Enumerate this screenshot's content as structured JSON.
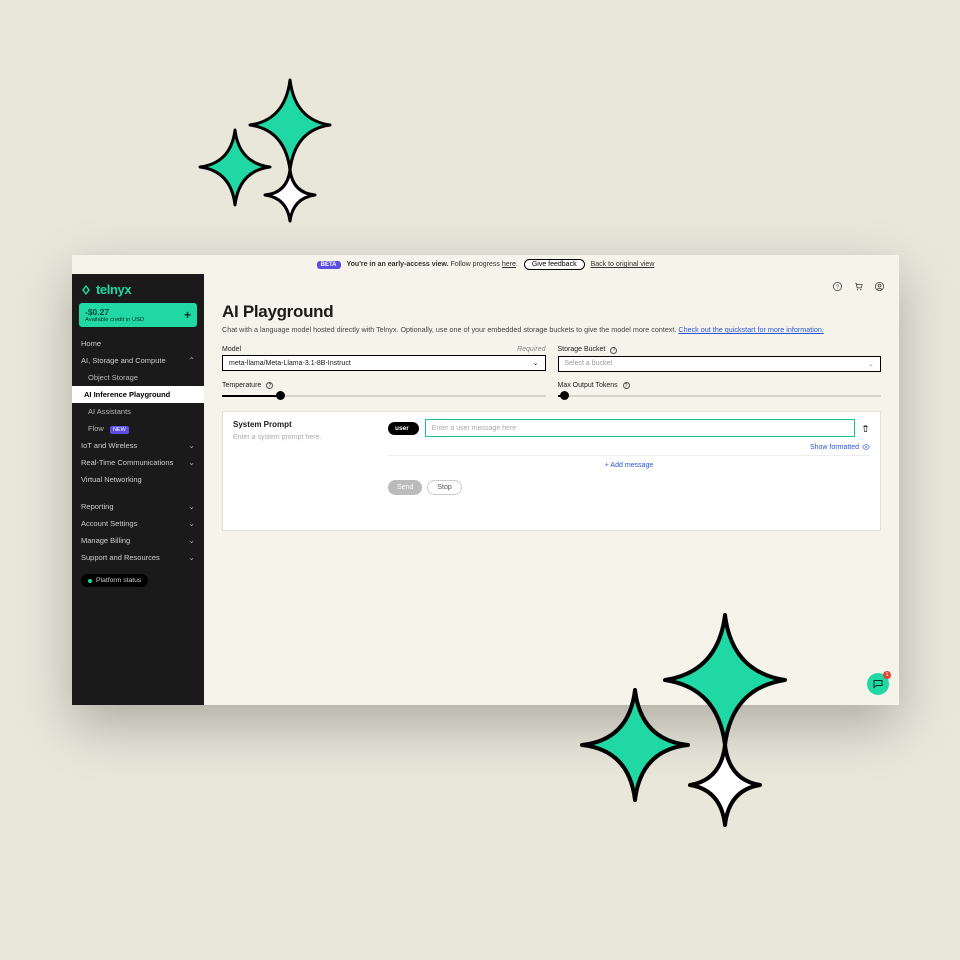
{
  "announcement": {
    "badge": "BETA",
    "bold": "You're in an early-access view.",
    "text": " Follow progress ",
    "here": "here",
    "period": ".",
    "feedback": "Give feedback",
    "back": "Back to original view"
  },
  "brand": "telnyx",
  "credit": {
    "amount": "-$0.27",
    "subtitle": "Available credit in USD",
    "plus": "+"
  },
  "sidebar": {
    "home": "Home",
    "ai_section": "AI, Storage and Compute",
    "subs": {
      "object_storage": "Object Storage",
      "ai_playground": "AI Inference Playground",
      "ai_assistants": "AI Assistants",
      "flow": "Flow",
      "flow_badge": "NEW"
    },
    "iot": "IoT and Wireless",
    "rtc": "Real-Time Communications",
    "vn": "Virtual Networking",
    "reporting": "Reporting",
    "account": "Account Settings",
    "billing": "Manage Billing",
    "support": "Support and Resources",
    "status": "Platform status"
  },
  "page": {
    "title": "AI Playground",
    "desc": "Chat with a language model hosted directly with Telnyx. Optionally, use one of your embedded storage buckets to give the model more context. ",
    "desc_link": "Check out the quickstart for more information."
  },
  "controls": {
    "model": {
      "label": "Model",
      "required": "Required",
      "value": "meta-llama/Meta-Llama-3.1-8B-Instruct"
    },
    "bucket": {
      "label": "Storage Bucket",
      "placeholder": "Select a bucket"
    },
    "temperature": {
      "label": "Temperature",
      "value": 0.18
    },
    "max_tokens": {
      "label": "Max Output Tokens",
      "value": 0.02
    }
  },
  "system_prompt": {
    "heading": "System Prompt",
    "placeholder": "Enter a system prompt here."
  },
  "message": {
    "role": "user",
    "placeholder": "Enter a user message here"
  },
  "links": {
    "show_formatted": "Show formatted",
    "add_message": "Add message"
  },
  "buttons": {
    "send": "Send",
    "stop": "Stop"
  },
  "chat_badge": "1",
  "colors": {
    "accent": "#1fd8a4",
    "link": "#2b56d9",
    "beta": "#5b4de0"
  }
}
